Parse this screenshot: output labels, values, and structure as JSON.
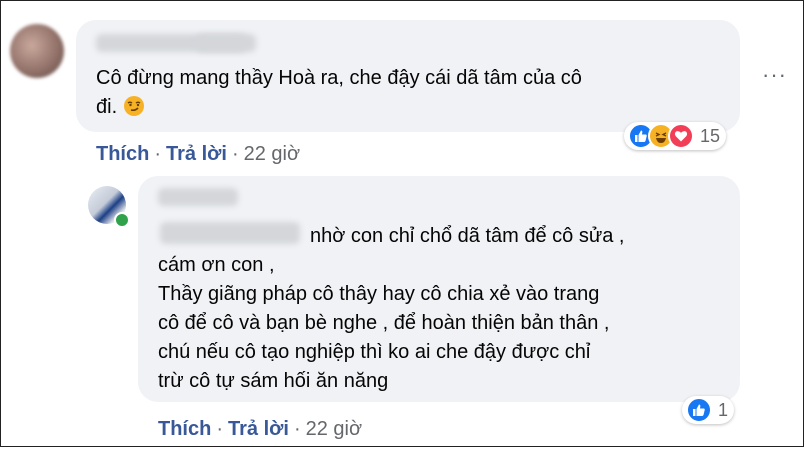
{
  "comment1": {
    "text_line1": "Cô đừng mang thầy Hoà ra, che đậy cái dã tâm của cô",
    "text_line2": "đi.",
    "emoji": "smirk-emoji",
    "actions": {
      "like": "Thích",
      "reply": "Trả lời",
      "time": "22 giờ",
      "sep": "·"
    },
    "reactions": {
      "icons": [
        "like-icon",
        "haha-icon",
        "love-icon"
      ],
      "count": "15"
    },
    "more": "···"
  },
  "reply1": {
    "lines": [
      "nhờ con chỉ chổ dã tâm để cô sửa ,",
      "cám ơn con ,",
      "Thầy giãng pháp cô thây hay cô chia xẻ vào trang",
      "cô để cô và bạn bè nghe , để hoàn thiện bản thân ,",
      "chú nếu cô tạo nghiệp thì ko ai che đậy được chỉ",
      "trừ cô tự sám hối ăn năng"
    ],
    "actions": {
      "like": "Thích",
      "reply": "Trả lời",
      "time": "22 giờ",
      "sep": "·"
    },
    "reactions": {
      "icons": [
        "like-icon"
      ],
      "count": "1"
    }
  },
  "colors": {
    "link": "#385898",
    "bubble": "#f0f2f5",
    "like": "#1877f2",
    "love": "#f33e58",
    "haha": "#f7b125",
    "online": "#31a24c"
  }
}
